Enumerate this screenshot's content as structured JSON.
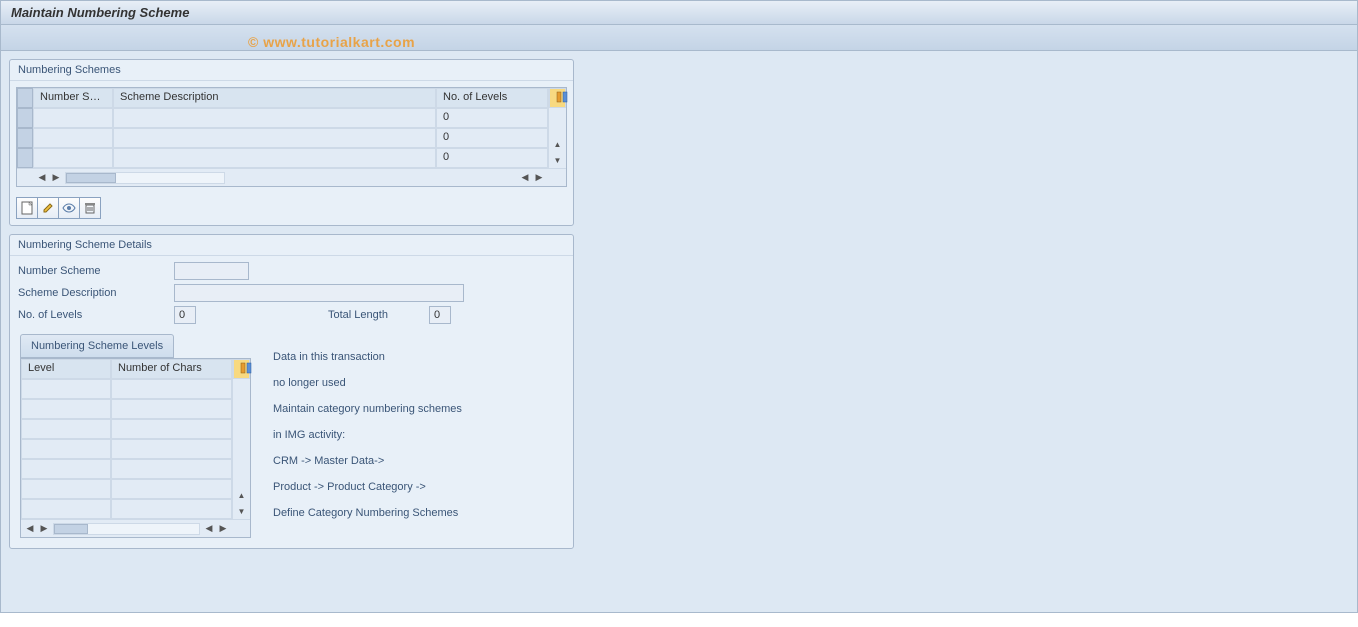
{
  "title": "Maintain Numbering Scheme",
  "watermark": "© www.tutorialkart.com",
  "schemesBox": {
    "title": "Numbering Schemes",
    "columns": {
      "c1": "Number S…",
      "c2": "Scheme Description",
      "c3": "No. of Levels"
    },
    "rows": [
      {
        "c1": "",
        "c2": "",
        "c3": "0"
      },
      {
        "c1": "",
        "c2": "",
        "c3": "0"
      },
      {
        "c1": "",
        "c2": "",
        "c3": "0"
      }
    ]
  },
  "detailsBox": {
    "title": "Numbering Scheme Details",
    "labels": {
      "numScheme": "Number Scheme",
      "schemeDesc": "Scheme Description",
      "noLevels": "No. of Levels",
      "totalLen": "Total Length"
    },
    "values": {
      "numScheme": "",
      "schemeDesc": "",
      "noLevels": "0",
      "totalLen": "0"
    },
    "levelsTab": "Numbering Scheme Levels",
    "levelsCols": {
      "c1": "Level",
      "c2": "Number of Chars"
    },
    "info": {
      "l1": "Data in this transaction",
      "l2": "no longer used",
      "l3": "Maintain category numbering schemes",
      "l4": "in IMG activity:",
      "l5": "CRM -> Master Data->",
      "l6": "Product -> Product Category ->",
      "l7": "Define Category Numbering Schemes"
    }
  }
}
